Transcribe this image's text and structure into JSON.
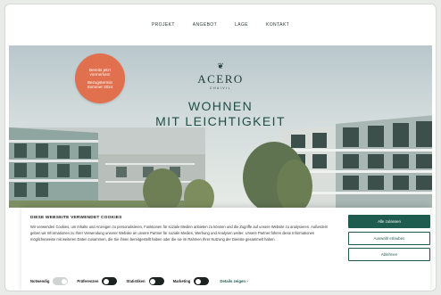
{
  "nav": {
    "items": [
      "PROJEKT",
      "ANGEBOT",
      "LAGE",
      "KONTAKT"
    ]
  },
  "logo": {
    "name": "ACERO",
    "sub": "CHAIVIL"
  },
  "headline": {
    "line1": "WOHNEN",
    "line2": "MIT LEICHTIGKEIT"
  },
  "badge": {
    "line1": "Bereits jetzt",
    "line2": "vormerken!",
    "line3": "Bezugstermin",
    "line4": "Sommer 2024"
  },
  "cookie": {
    "title": "DIESE WEBSEITE VERWENDET COOKIES",
    "text": "Wir verwenden Cookies, um Inhalte und Anzeigen zu personalisieren, Funktionen für soziale Medien anbieten zu können und die Zugriffe auf unsere Website zu analysieren. Außerdem geben wir Informationen zu Ihrer Verwendung unserer Website an unsere Partner für soziale Medien, Werbung und Analysen weiter. Unsere Partner führen diese Informationen möglicherweise mit weiteren Daten zusammen, die Sie ihnen bereitgestellt haben oder die sie im Rahmen Ihrer Nutzung der Dienste gesammelt haben.",
    "buttons": {
      "allow_all": "Alle zulassen",
      "allow_selection": "Auswahl erlauben",
      "decline": "Ablehnen"
    },
    "toggles": [
      {
        "label": "Notwendig",
        "state": "on"
      },
      {
        "label": "Präferenzen",
        "state": "off"
      },
      {
        "label": "Statistiken",
        "state": "off"
      },
      {
        "label": "Marketing",
        "state": "off"
      }
    ],
    "details_label": "Details zeigen",
    "details_icon": "chevron-right-icon",
    "details_glyph": "›"
  }
}
